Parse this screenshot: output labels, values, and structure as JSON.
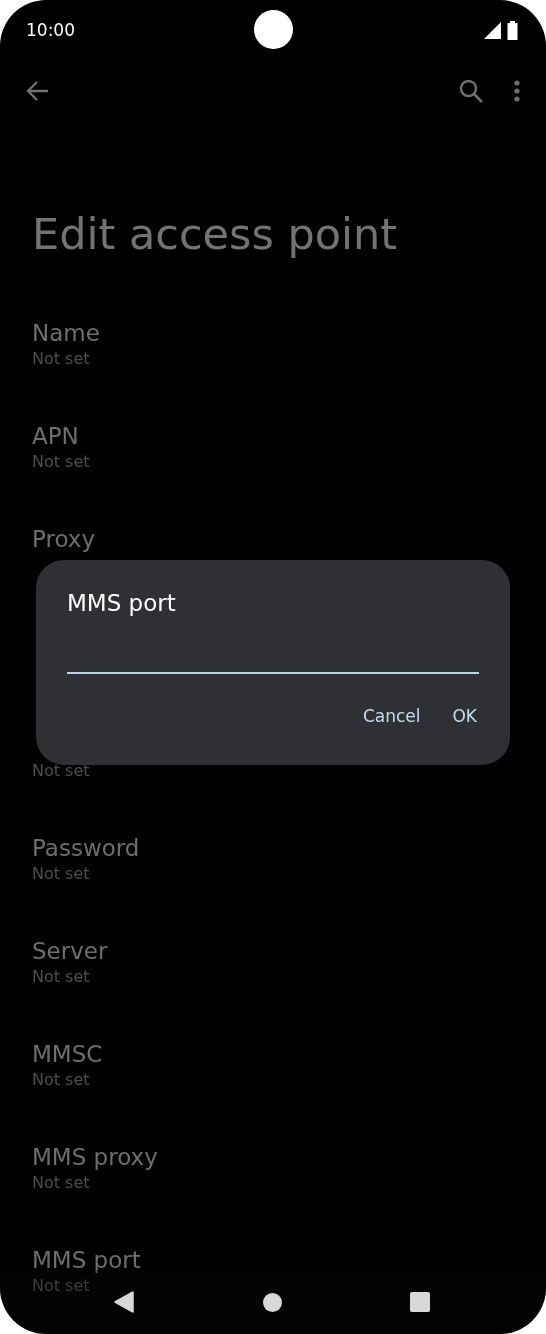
{
  "status_bar": {
    "time": "10:00"
  },
  "title": "Edit access point",
  "settings": [
    {
      "kind": "full",
      "title": "Name",
      "value": "Not set"
    },
    {
      "kind": "full",
      "title": "APN",
      "value": "Not set"
    },
    {
      "kind": "title_only",
      "title": "Proxy"
    },
    {
      "kind": "covered"
    },
    {
      "kind": "value_only",
      "value": "Not set"
    },
    {
      "kind": "full",
      "title": "Password",
      "value": "Not set"
    },
    {
      "kind": "full",
      "title": "Server",
      "value": "Not set"
    },
    {
      "kind": "full",
      "title": "MMSC",
      "value": "Not set"
    },
    {
      "kind": "full",
      "title": "MMS proxy",
      "value": "Not set"
    },
    {
      "kind": "full",
      "title": "MMS port",
      "value": "Not set"
    }
  ],
  "dialog": {
    "title": "MMS port",
    "buttons": [
      "Cancel",
      "OK"
    ]
  }
}
